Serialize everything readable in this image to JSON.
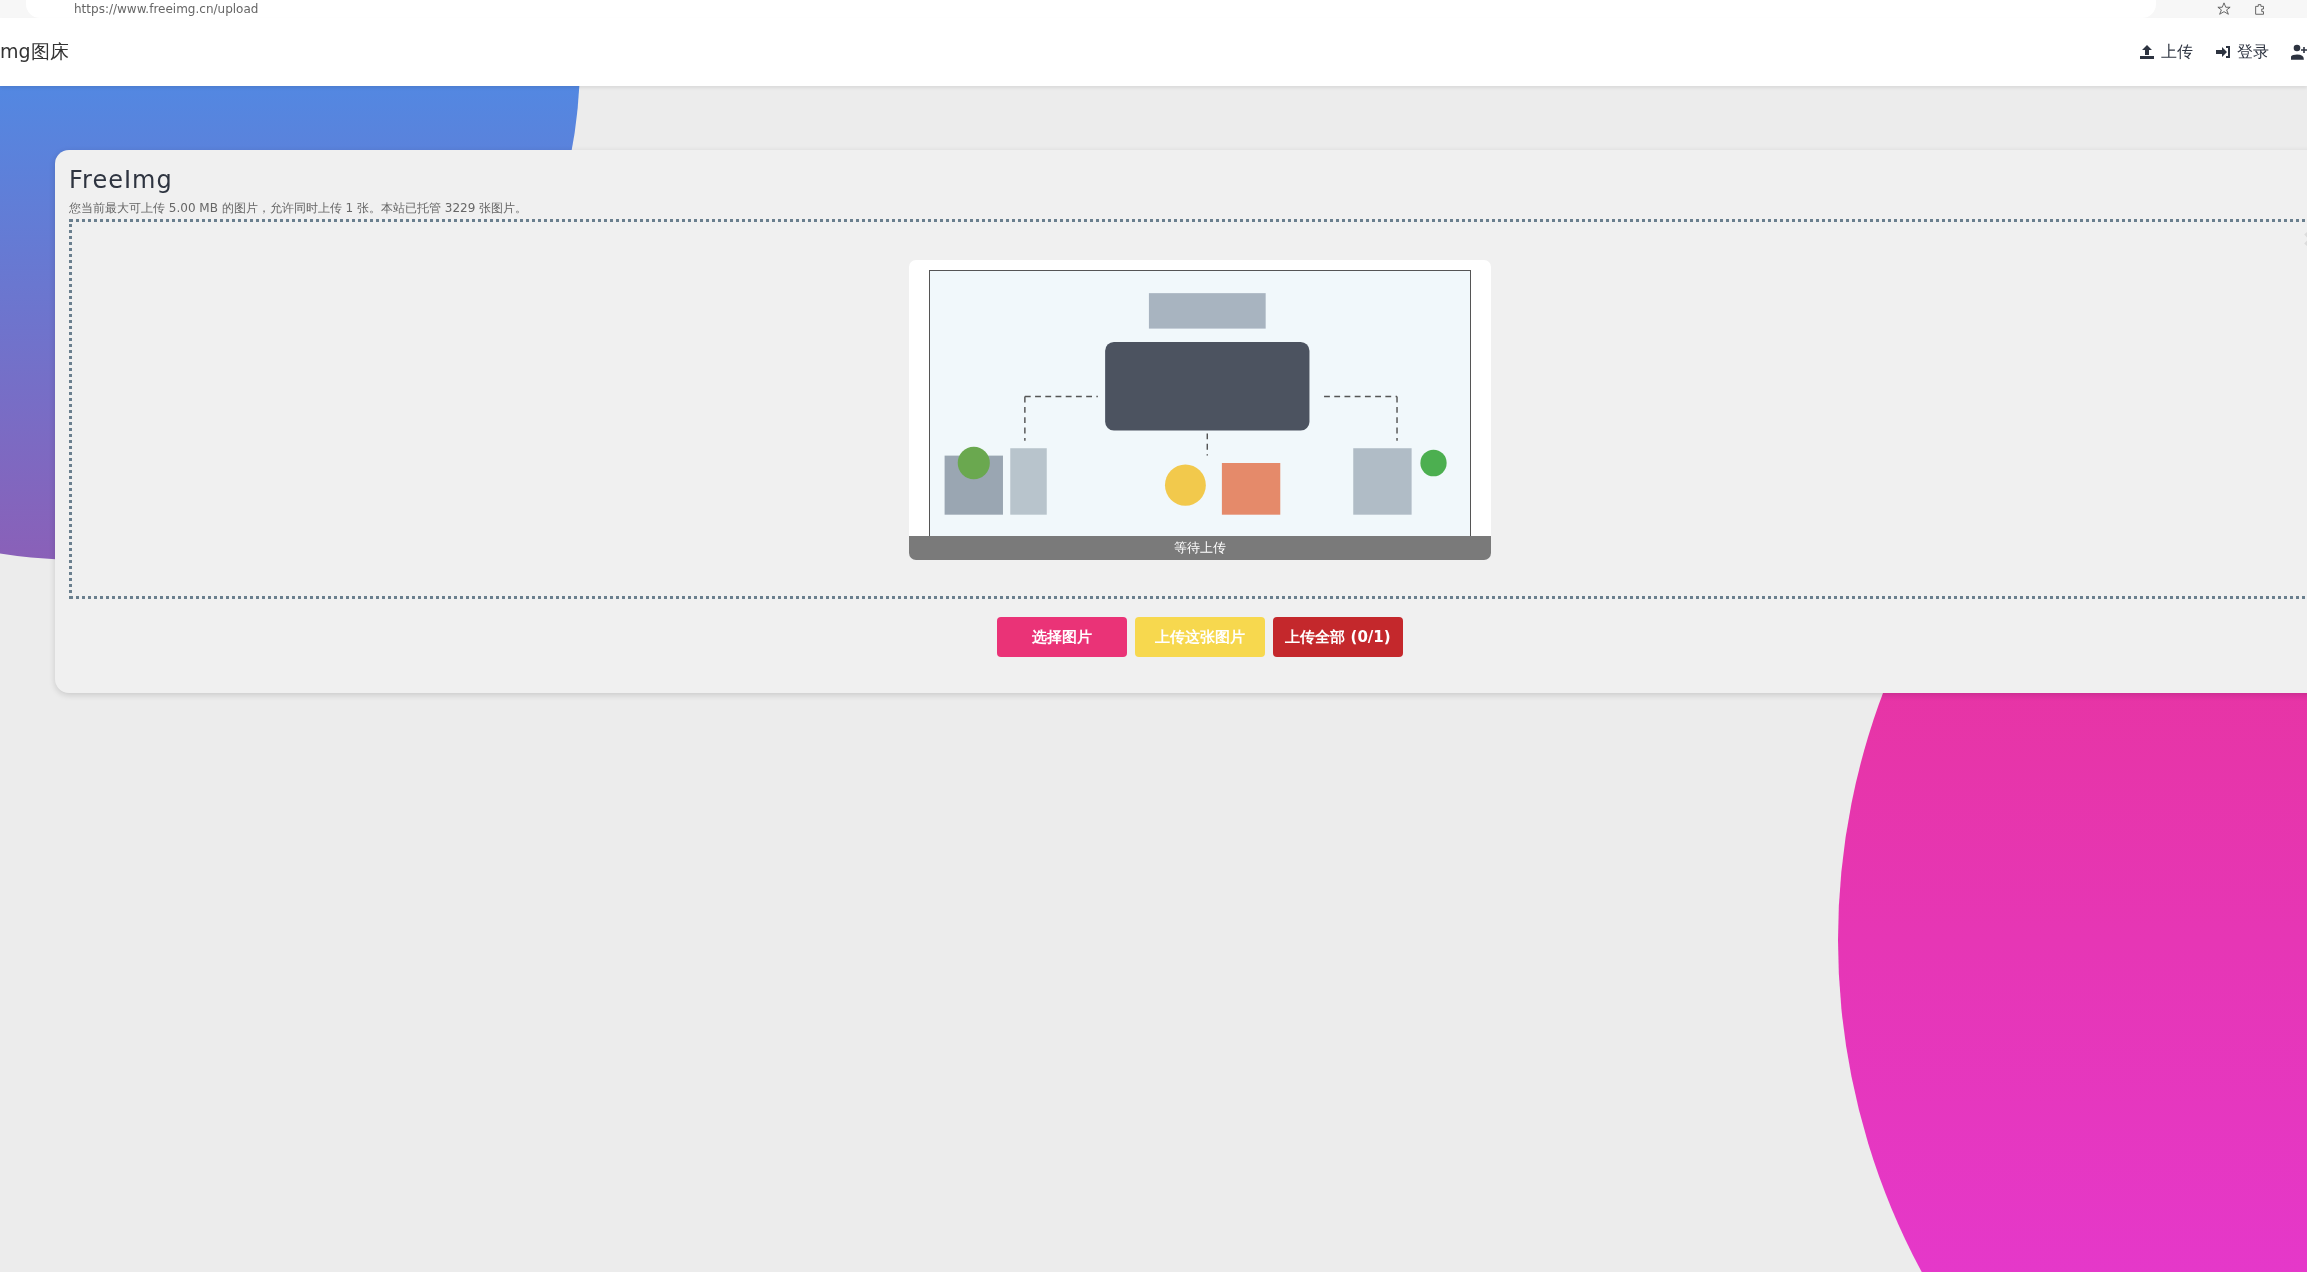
{
  "browser": {
    "url": "https://www.freeimg.cn/upload"
  },
  "navbar": {
    "brand": "mg图床",
    "links": [
      {
        "kind": "upload",
        "label": "上传"
      },
      {
        "kind": "login",
        "label": "登录"
      },
      {
        "kind": "register"
      }
    ]
  },
  "card": {
    "title": "FreeImg",
    "subtitle": "您当前最大可上传 5.00 MB 的图片，允许同时上传 1 张。本站已托管 3229 张图片。",
    "preview": {
      "status": "等待上传"
    },
    "buttons": [
      {
        "kind": "choose",
        "label": "选择图片"
      },
      {
        "kind": "upload-one",
        "label": "上传这张图片"
      },
      {
        "kind": "upload-all",
        "label": "上传全部 (0/1)"
      }
    ]
  }
}
